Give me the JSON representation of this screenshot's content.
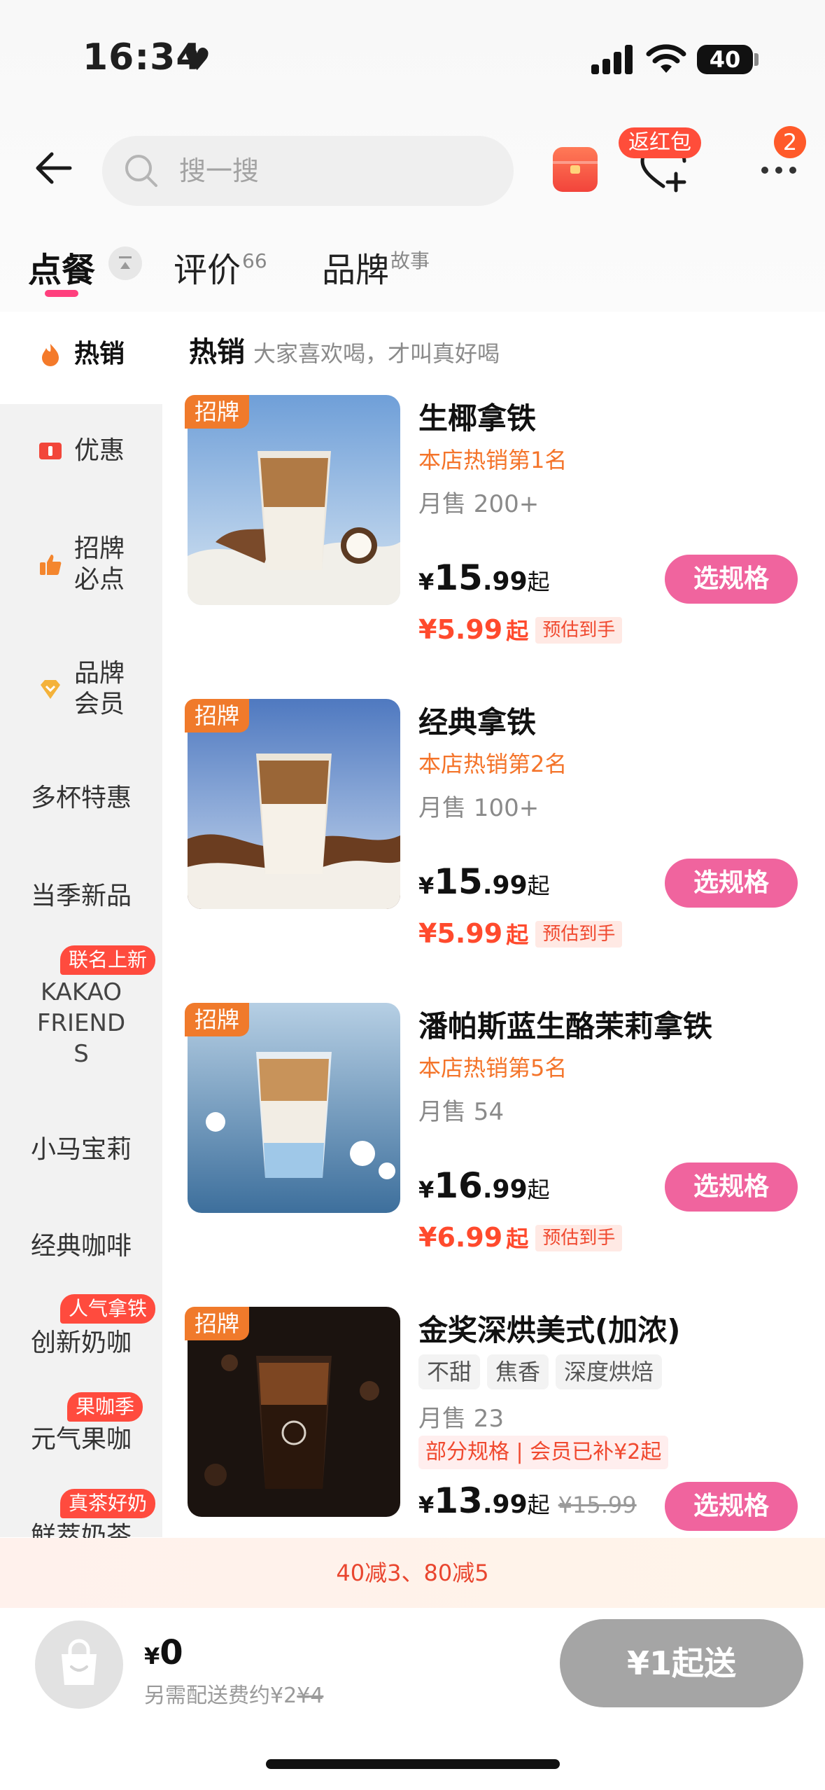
{
  "status_bar": {
    "time": "16:34",
    "battery": "40"
  },
  "search": {
    "placeholder": "搜一搜"
  },
  "header": {
    "redpack_label": "返红包",
    "more_count": "2"
  },
  "tabs": [
    {
      "label": "点餐",
      "sup": ""
    },
    {
      "label": "评价",
      "sup": "66"
    },
    {
      "label": "品牌",
      "sup": "故事"
    }
  ],
  "sidebar": {
    "items": [
      {
        "label": "热销"
      },
      {
        "label": "优惠"
      },
      {
        "label": "招牌必点",
        "line1": "招牌",
        "line2": "必点"
      },
      {
        "label": "品牌会员",
        "line1": "品牌",
        "line2": "会员"
      },
      {
        "label": "多杯特惠"
      },
      {
        "label": "当季新品"
      },
      {
        "label": "KAKAO FRIENDS",
        "line1": "KAKAO",
        "line2": "FRIEND",
        "line3": "S",
        "badge": "联名上新"
      },
      {
        "label": "小马宝莉"
      },
      {
        "label": "经典咖啡"
      },
      {
        "label": "创新奶咖",
        "badge": "人气拿铁"
      },
      {
        "label": "元气果咖",
        "badge": "果咖季"
      },
      {
        "label": "鲜萃奶茶",
        "badge": "真茶好奶"
      }
    ]
  },
  "list": {
    "header_title": "热销",
    "header_sub": "大家喜欢喝，才叫真好喝"
  },
  "products": [
    {
      "tag": "招牌",
      "name": "生椰拿铁",
      "rank": "本店热销第1名",
      "sales": "月售 200+",
      "price_cur": "¥",
      "price_int": "15",
      "price_dec": ".99",
      "price_suffix": "起",
      "est_price": "¥5.99",
      "est_suffix": "起",
      "est_tag": "预估到手",
      "button": "选规格"
    },
    {
      "tag": "招牌",
      "name": "经典拿铁",
      "rank": "本店热销第2名",
      "sales": "月售 100+",
      "price_cur": "¥",
      "price_int": "15",
      "price_dec": ".99",
      "price_suffix": "起",
      "est_price": "¥5.99",
      "est_suffix": "起",
      "est_tag": "预估到手",
      "button": "选规格"
    },
    {
      "tag": "招牌",
      "name": "潘帕斯蓝生酪茉莉拿铁",
      "rank": "本店热销第5名",
      "sales": "月售 54",
      "price_cur": "¥",
      "price_int": "16",
      "price_dec": ".99",
      "price_suffix": "起",
      "est_price": "¥6.99",
      "est_suffix": "起",
      "est_tag": "预估到手",
      "button": "选规格"
    },
    {
      "tag": "招牌",
      "name": "金奖深烘美式(加浓)",
      "chips": [
        "不甜",
        "焦香",
        "深度烘焙"
      ],
      "sales": "月售 23",
      "member": "部分规格 | 会员已补¥2起",
      "price_cur": "¥",
      "price_int": "13",
      "price_dec": ".99",
      "price_suffix": "起",
      "orig_price": "¥15.99",
      "button": "选规格"
    }
  ],
  "promo": {
    "text": "40减3、80减5"
  },
  "cart": {
    "price_cur": "¥",
    "price": "0",
    "delivery_prefix": "另需配送费约¥2",
    "delivery_orig": "¥4",
    "min_order": "¥1起送"
  },
  "colors": {
    "accent_pink": "#f0649e",
    "price_red": "#ff4a2d",
    "rank_orange": "#f4742a",
    "tag_orange": "#f07a2b"
  }
}
